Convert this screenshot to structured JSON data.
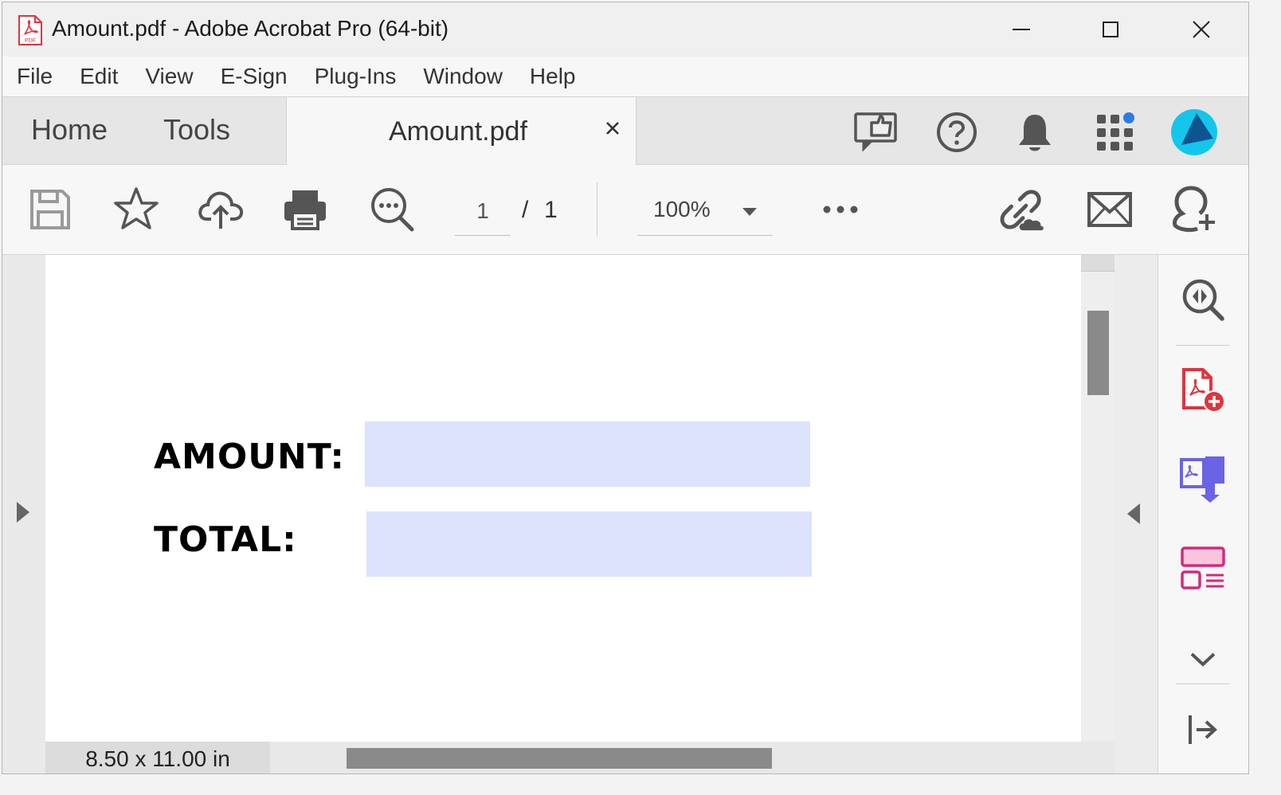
{
  "window": {
    "title": "Amount.pdf - Adobe Acrobat Pro (64-bit)"
  },
  "menu": [
    "File",
    "Edit",
    "View",
    "E-Sign",
    "Plug-Ins",
    "Window",
    "Help"
  ],
  "tabs": {
    "home": "Home",
    "tools": "Tools",
    "document": "Amount.pdf"
  },
  "header_icons": [
    "share-review-icon",
    "help-icon",
    "bell-icon",
    "apps-grid-icon",
    "avatar"
  ],
  "toolbar": {
    "current_page": "1",
    "page_separator": "/",
    "total_pages": "1",
    "zoom": "100%"
  },
  "document": {
    "labels": {
      "amount": "AMOUNT:",
      "total": "TOTAL:"
    },
    "field_color": "#dde2fd"
  },
  "status": {
    "page_size": "8.50 x 11.00 in"
  },
  "colors": {
    "acrobat_red": "#e0343f",
    "notification_dot": "#2f7be6",
    "avatar": "#14c6ec",
    "combine_purple": "#6a63e6",
    "organize_pink": "#d6287b"
  }
}
